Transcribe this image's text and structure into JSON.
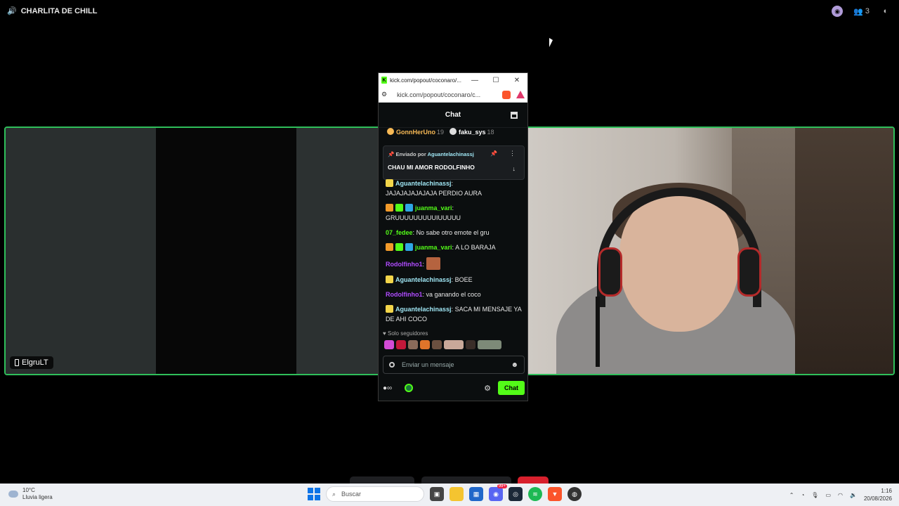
{
  "topbar": {
    "channel_name": "CHARLITA DE CHILL",
    "member_count": "3",
    "icons": [
      "speaker-icon",
      "discord-activity-icon",
      "people-icon",
      "inbox-icon"
    ]
  },
  "stage": {
    "participant_name": "ElgruLT",
    "accent_color": "#2fbf5a"
  },
  "popout": {
    "window_title": "kick.com/popout/coconaro/...",
    "url": "kick.com/popout/coconaro/c...",
    "chat_title": "Chat",
    "gifters": [
      {
        "name": "GonnHerUno",
        "count": "19",
        "color": "#f7b955"
      },
      {
        "name": "faku_sys",
        "count": "18",
        "color": "#dddddd"
      }
    ],
    "pinned": {
      "label": "Enviado por",
      "user": "Aguantelachinassj",
      "message": "CHAU MI AMOR RODOLFINHO"
    },
    "messages": [
      {
        "user": "Aguantelachinassj",
        "sep": ":",
        "text": "JAJAJAJAJAJAJA PERDIO AURA",
        "color": "#a0e7f5"
      },
      {
        "user": "juanma_vari",
        "sep": ":",
        "text": "GRUUUUUUUUUIUUUUU",
        "color": "#53fc18"
      },
      {
        "user": "07_fedee",
        "sep": ":",
        "text": "No sabe otro emote el gru",
        "color": "#53fc18"
      },
      {
        "user": "juanma_vari",
        "sep": ":",
        "text": "A LO BARAJA",
        "color": "#53fc18"
      },
      {
        "user": "Rodolfinho1",
        "sep": ":",
        "text": "",
        "color": "#b04cff"
      },
      {
        "user": "Aguantelachinassj",
        "sep": ":",
        "text": "BOEE",
        "color": "#a0e7f5"
      },
      {
        "user": "Rodolfinho1",
        "sep": ":",
        "text": "va ganando el coco",
        "color": "#b04cff"
      },
      {
        "user": "Aguantelachinassj",
        "sep": ":",
        "text": "SACA MI MENSAJE YA DE AHI COCO",
        "color": "#a0e7f5"
      }
    ],
    "followers_only": "Solo seguidores",
    "input_placeholder": "Enviar un mensaje",
    "send_label": "Chat",
    "brand_color": "#53fc18"
  },
  "taskbar": {
    "weather_temp": "10°C",
    "weather_desc": "Lluvia ligera",
    "search_placeholder": "Buscar",
    "time": "1:16",
    "date": "20/08/2026",
    "discord_badge": "99+"
  }
}
